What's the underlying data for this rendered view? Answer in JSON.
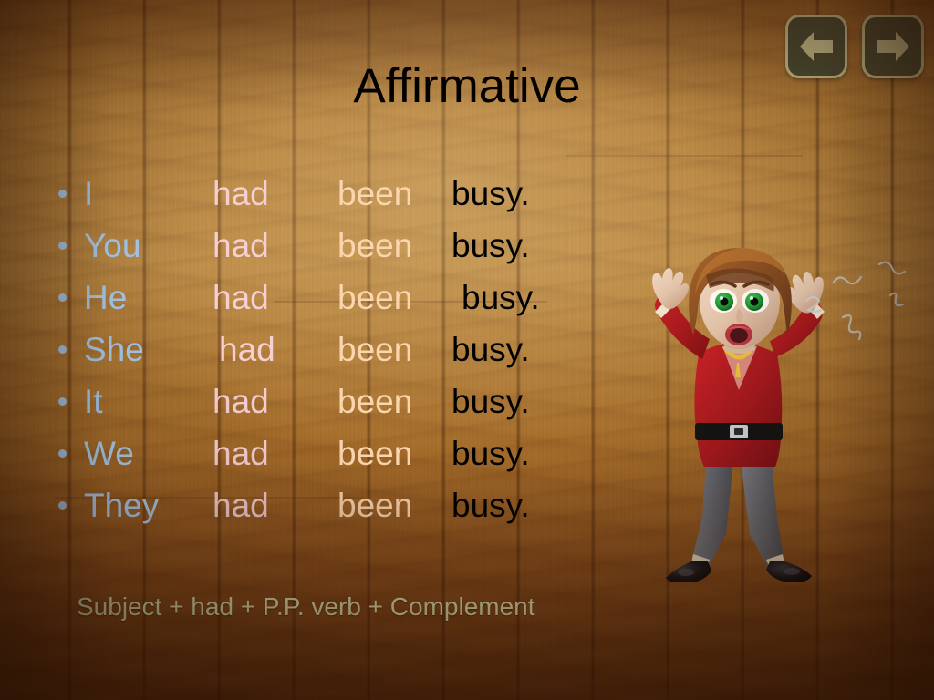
{
  "slide": {
    "title": "Affirmative",
    "formula": "Subject + had + P.P. verb + Complement",
    "background": "wood-plank-texture",
    "colors": {
      "title": "#000000",
      "bullet": "#a9cdf0",
      "subject": "#a9cdf0",
      "auxiliary": "#f6cfd2",
      "participle": "#fbd5ae",
      "complement": "#000000",
      "formula": "#e3e8b4",
      "nav_button_fill": "#4b4c33",
      "nav_button_border": "#c7c08b",
      "wood_light": "#bb8a43",
      "wood_dark": "#6e3a12"
    }
  },
  "nav": {
    "prev_label": "previous-slide",
    "next_label": "next-slide",
    "prev_icon": "left-arrow-icon",
    "next_icon": "right-arrow-icon"
  },
  "rows": [
    {
      "subject": "I",
      "aux": "had",
      "participle": "been",
      "complement": "busy."
    },
    {
      "subject": "You",
      "aux": "had",
      "participle": "been",
      "complement": "busy."
    },
    {
      "subject": "He",
      "aux": "had",
      "participle": "been",
      "complement": "busy."
    },
    {
      "subject": "She",
      "aux": "had",
      "participle": "been",
      "complement": "busy."
    },
    {
      "subject": "It",
      "aux": "had",
      "participle": "been",
      "complement": "busy."
    },
    {
      "subject": "We",
      "aux": "had",
      "participle": "been",
      "complement": "busy."
    },
    {
      "subject": "They",
      "aux": "had",
      "participle": "been",
      "complement": "busy."
    }
  ],
  "illustration": {
    "name": "stressed-woman-character",
    "description": "3D cartoon woman with brown bob hair, green eyes, open mouth, red top, black belt, gray pants, black shoes, hands raised",
    "hair_color": "#8a4f22",
    "skin_color": "#e8cbb4",
    "eye_color": "#1f9a33",
    "top_color": "#b01c20",
    "pants_color": "#6a6c72",
    "shoe_color": "#131316",
    "belt_color": "#141414",
    "necklace_color": "#e8c23a",
    "stress_marks": "squiggle-icon"
  }
}
